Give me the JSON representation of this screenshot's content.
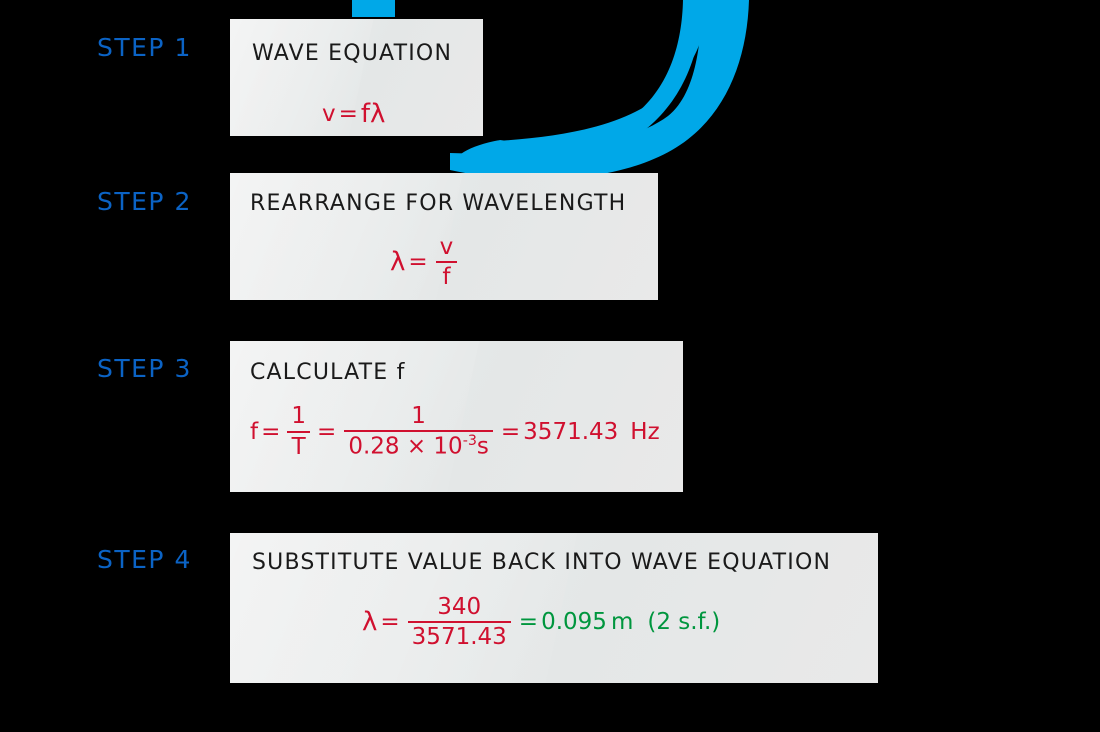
{
  "page": {
    "background_color": "#000000",
    "accent_blue": "#00A8E8",
    "label_blue": "#0B63C5",
    "formula_red": "#D0102F",
    "result_green": "#00963E",
    "box_fill": "#E8E9E9"
  },
  "decoration": {
    "swoosh_name": "blue-swoosh-ribbon",
    "swoosh_color": "#00A8E8",
    "tab_name": "blue-top-tab",
    "tab_color": "#00A8E8"
  },
  "steps": [
    {
      "label": "STEP  1",
      "title": "WAVE   EQUATION",
      "formula": {
        "lhs": "v",
        "equals": "=",
        "rhs": "fλ"
      }
    },
    {
      "label": "STEP  2",
      "title": "REARRANGE  FOR  WAVELENGTH",
      "formula": {
        "lhs": "λ",
        "equals": "=",
        "numerator": "v",
        "denominator": "f"
      }
    },
    {
      "label": "STEP  3",
      "title": "CALCULATE   f",
      "formula": {
        "lhs": "f",
        "equals1": "=",
        "frac1_num": "1",
        "frac1_den": "T",
        "equals2": "=",
        "frac2_num": "1",
        "frac2_den_value": "0.28 × 10",
        "frac2_den_exponent": "-3",
        "frac2_den_unit": "s",
        "equals3": "=",
        "result": "3571.43",
        "result_unit": "Hz"
      }
    },
    {
      "label": "STEP  4",
      "title": "SUBSTITUTE  VALUE  BACK  INTO  WAVE  EQUATION",
      "formula": {
        "lhs": "λ",
        "equals1": "=",
        "frac_num": "340",
        "frac_den": "3571.43",
        "equals2": "=",
        "result": "0.095",
        "result_unit": "m",
        "result_note": "(2 s.f.)"
      }
    }
  ]
}
